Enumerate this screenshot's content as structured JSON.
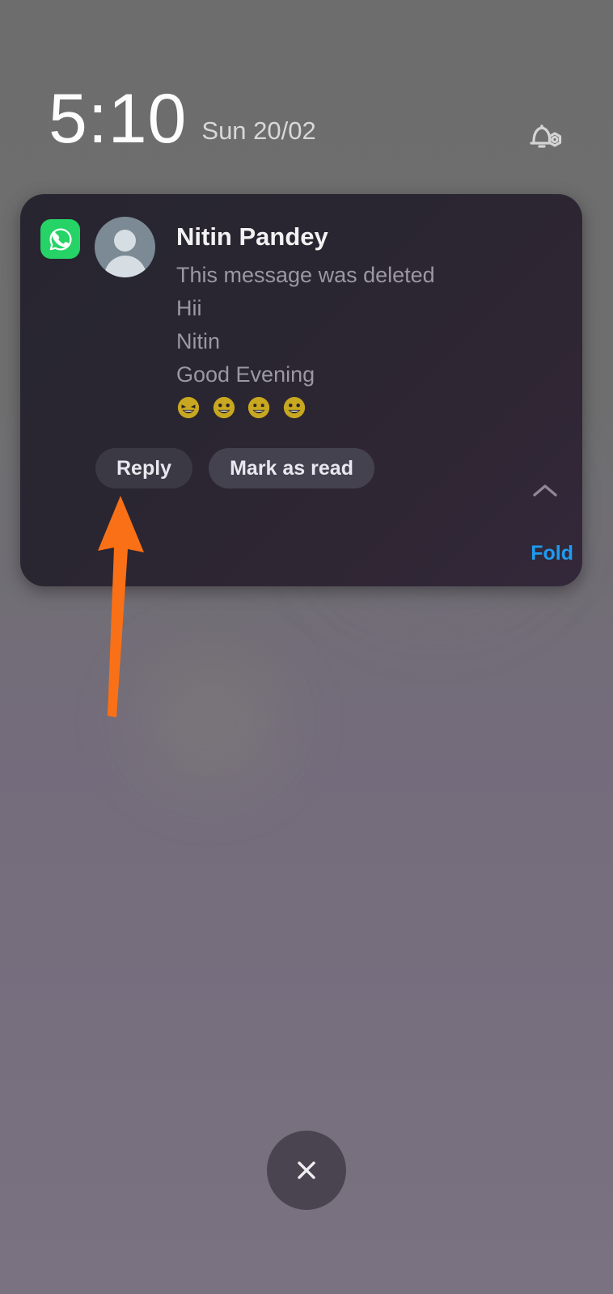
{
  "status": {
    "time": "5:10",
    "date": "Sun 20/02",
    "settings_icon": "bell-gear-icon"
  },
  "notification": {
    "app_icon": "whatsapp-icon",
    "avatar_icon": "contact-avatar-placeholder",
    "title": "Nitin Pandey",
    "messages": [
      "This message was deleted",
      "Hii",
      "Nitin",
      "Good Evening"
    ],
    "emoji_row": {
      "label": "grinning-squinting-face",
      "count": 4
    },
    "actions": {
      "reply_label": "Reply",
      "mark_as_read_label": "Mark as read"
    },
    "fold_label": "Fold",
    "collapse_icon": "chevron-up-icon"
  },
  "annotation": {
    "arrow_icon": "up-arrow-annotation",
    "arrow_color": "#FA7016",
    "points_at": "Reply"
  },
  "bottom_bar": {
    "close_icon": "close-x-icon"
  },
  "colors": {
    "whatsapp_green": "#25D366",
    "fold_blue": "#1F9BF0",
    "card_dark": "#272530",
    "card_purple": "#33283A",
    "wallpaper_top": "#6E6E6E",
    "wallpaper_bottom": "#7A7280",
    "annotation_orange": "#FA7016"
  }
}
